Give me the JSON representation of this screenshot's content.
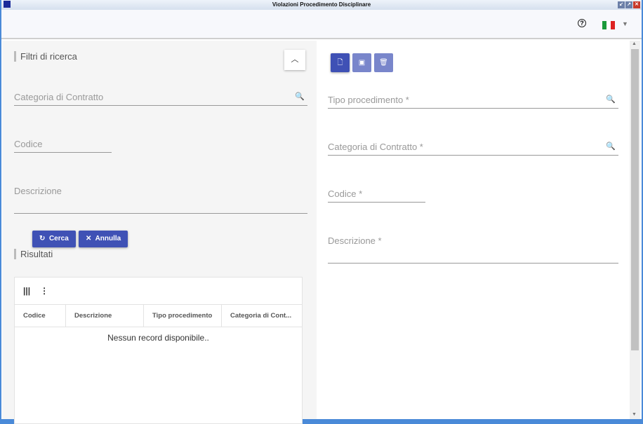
{
  "window": {
    "title": "Violazioni Procedimento Disciplinare"
  },
  "header": {
    "help_icon": "question-circle-icon",
    "language": "it"
  },
  "filters": {
    "title": "Filtri di ricerca",
    "categoria_placeholder": "Categoria di Contratto",
    "codice_placeholder": "Codice",
    "descrizione_placeholder": "Descrizione",
    "search_label": "Cerca",
    "cancel_label": "Annulla"
  },
  "results": {
    "title": "Risultati",
    "columns": [
      "Codice",
      "Descrizione",
      "Tipo procedimento",
      "Categoria di Cont..."
    ],
    "empty_text": "Nessun record disponibile.."
  },
  "form": {
    "tipo_placeholder": "Tipo procedimento *",
    "categoria_placeholder": "Categoria di Contratto *",
    "codice_placeholder": "Codice *",
    "descrizione_placeholder": "Descrizione *"
  },
  "colors": {
    "primary": "#3f51b5",
    "primary_disabled": "#7986cb"
  }
}
